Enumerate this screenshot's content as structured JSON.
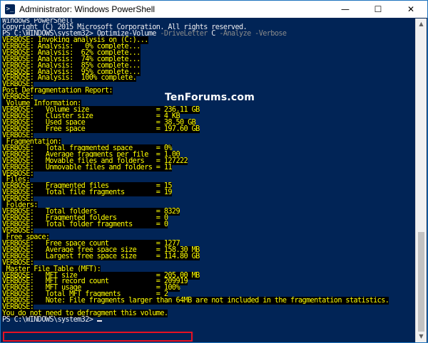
{
  "window": {
    "title": "Administrator: Windows PowerShell",
    "icon": "powershell-icon",
    "controls": {
      "minimize": "—",
      "maximize": "☐",
      "close": "✕"
    }
  },
  "colors": {
    "console_bg": "#012456",
    "console_text": "#eeedf0",
    "verbose_text": "#ffff00",
    "verbose_bg": "#000000",
    "param_text": "#8a8a8a",
    "highlight_border": "#e81123"
  },
  "watermark": "TenForums.com",
  "console": {
    "header": [
      "Windows PowerShell",
      "Copyright (C) 2015 Microsoft Corporation. All rights reserved."
    ],
    "prompt": {
      "path": "PS C:\\WINDOWS\\system32> ",
      "command": "Optimize-Volume",
      "param1": " -DriveLetter",
      "arg1": " C",
      "param2": " -Analyze -Verbose"
    },
    "verbose": [
      "VERBOSE: Invoking analysis on (C:)...",
      "VERBOSE: Analysis:   0% complete...",
      "VERBOSE: Analysis:  62% complete...",
      "VERBOSE: Analysis:  74% complete...",
      "VERBOSE: Analysis:  85% complete...",
      "VERBOSE: Analysis:  95% complete...",
      "VERBOSE: Analysis:  100% complete.",
      "VERBOSE:",
      "Post Defragmentation Report:",
      "VERBOSE:",
      " Volume Information:",
      "VERBOSE:   Volume size                 = 236.11 GB",
      "VERBOSE:   Cluster size                = 4 KB",
      "VERBOSE:   Used space                  = 38.50 GB",
      "VERBOSE:   Free space                  = 197.60 GB",
      "VERBOSE:",
      " Fragmentation:",
      "VERBOSE:   Total fragmented space      = 0%",
      "VERBOSE:   Average fragments per file  = 1.00",
      "VERBOSE:   Movable files and folders   = 127222",
      "VERBOSE:   Unmovable files and folders = 11",
      "VERBOSE:",
      " Files:",
      "VERBOSE:   Fragmented files            = 15",
      "VERBOSE:   Total file fragments        = 19",
      "VERBOSE:",
      " Folders:",
      "VERBOSE:   Total folders               = 8329",
      "VERBOSE:   Fragmented folders          = 0",
      "VERBOSE:   Total folder fragments      = 0",
      "VERBOSE:",
      " Free space:",
      "VERBOSE:   Free space count            = 1277",
      "VERBOSE:   Average free space size     = 158.30 MB",
      "VERBOSE:   Largest free space size     = 114.80 GB",
      "VERBOSE:",
      " Master File Table (MFT):",
      "VERBOSE:   MFT size                    = 205.00 MB",
      "VERBOSE:   MFT record count            = 209919",
      "VERBOSE:   MFT usage                   = 100%",
      "VERBOSE:   Total MFT fragments         = 2",
      "VERBOSE:   Note: File fragments larger than 64MB are not included in the fragmentation statistics.",
      "VERBOSE:"
    ],
    "result": "You do not need to defragment this volume.",
    "final_prompt": "PS C:\\WINDOWS\\system32> "
  }
}
